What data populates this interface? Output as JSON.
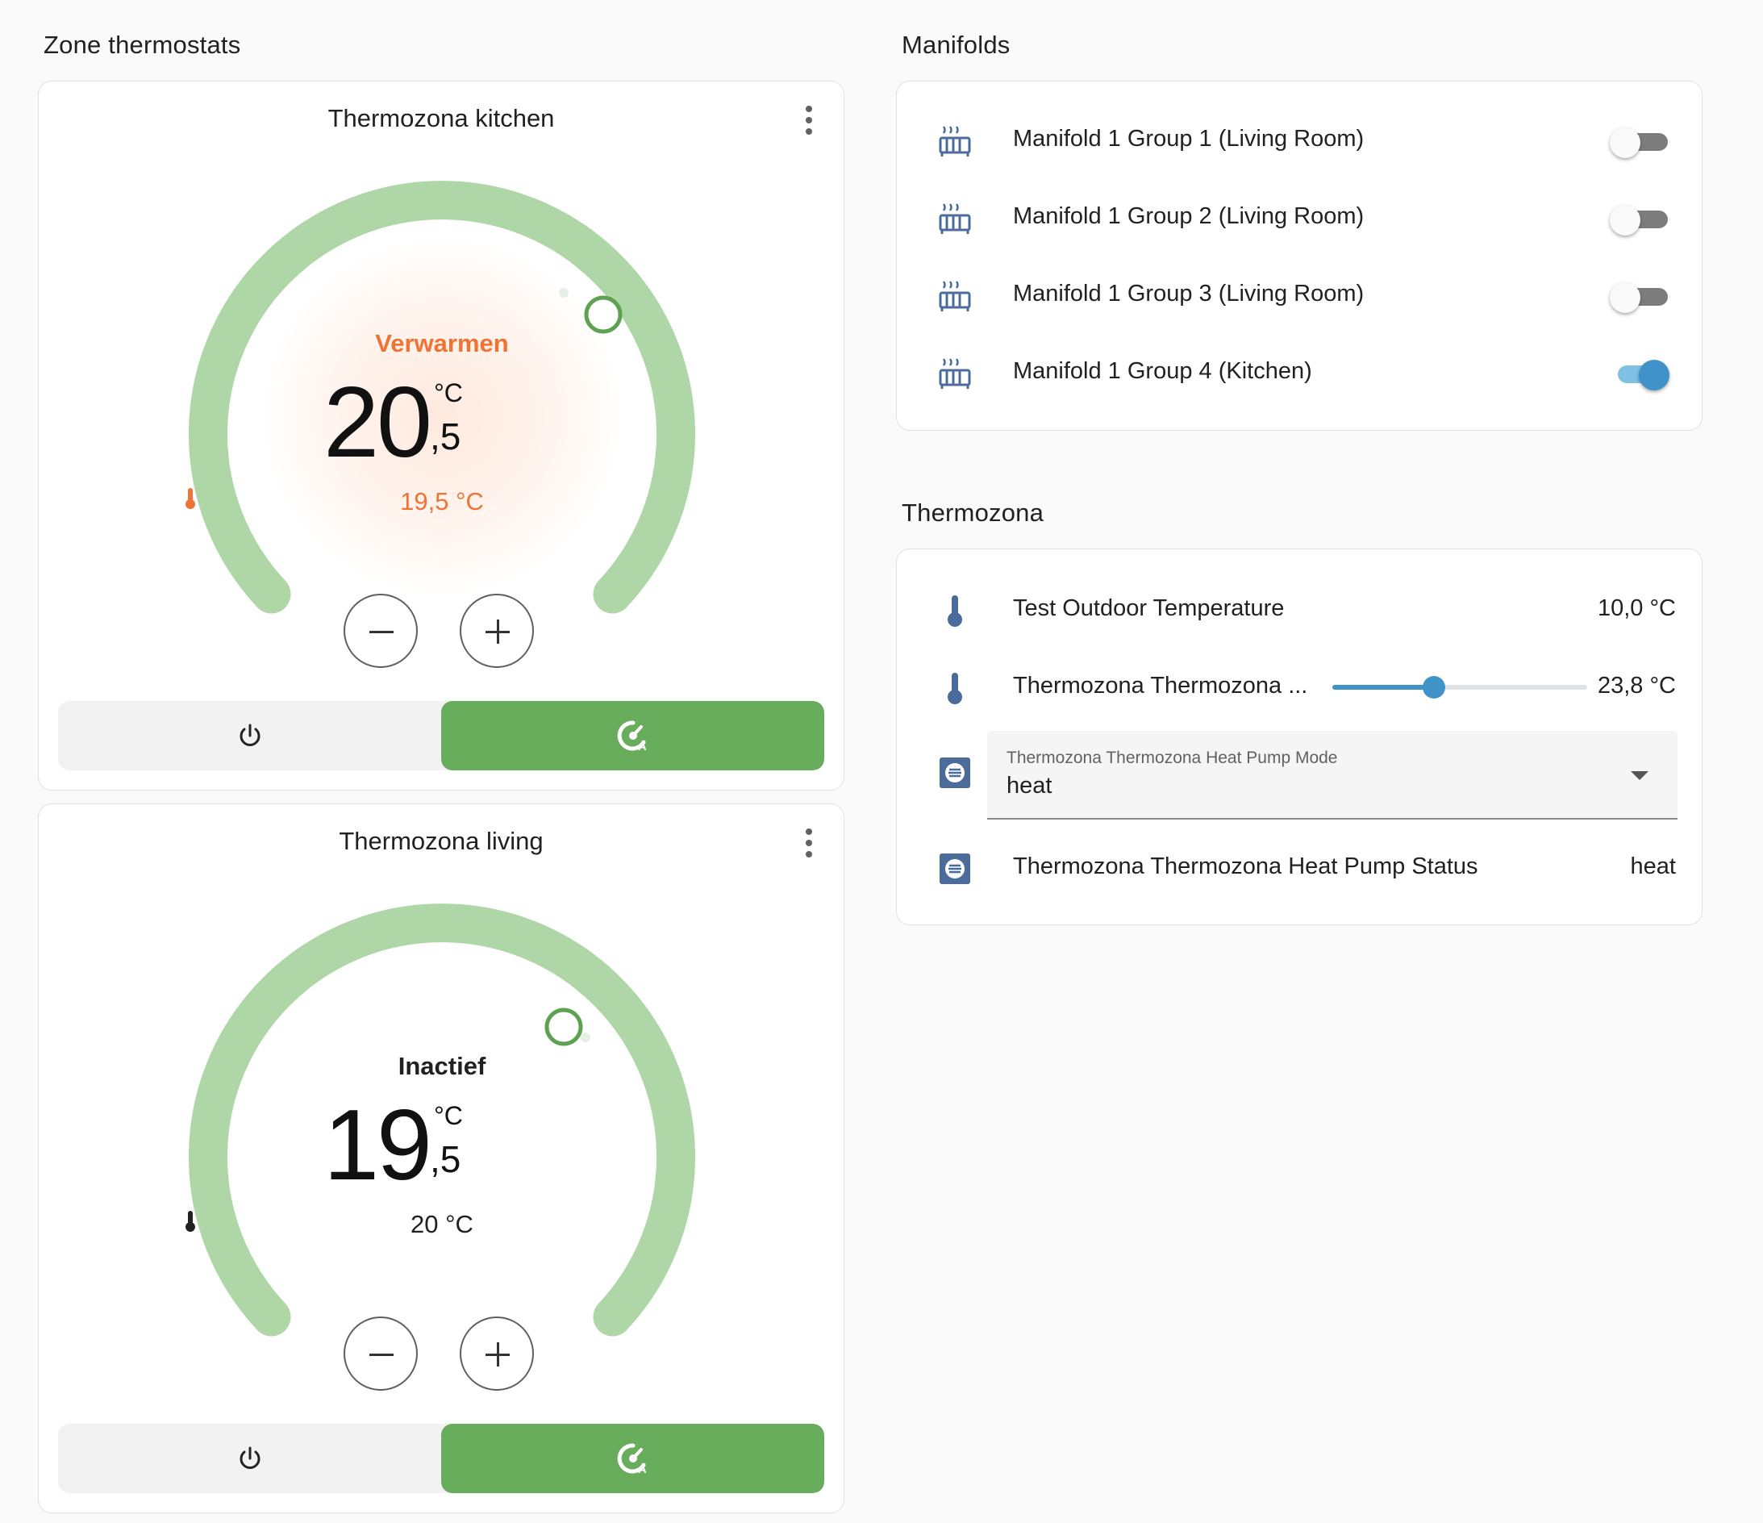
{
  "sections": {
    "zones_title": "Zone thermostats",
    "manifolds_title": "Manifolds",
    "thermozona_title": "Thermozona"
  },
  "thermostats": [
    {
      "name": "Thermozona kitchen",
      "state": "Verwarmen",
      "state_color": "#ef7335",
      "target_whole": "20",
      "target_decimal": ",5",
      "unit": "°C",
      "current": "19,5 °C",
      "current_color": "#ef7335",
      "arc_color": "#afd6a7",
      "heating_glow": true,
      "modes": [
        "power-icon",
        "auto-icon"
      ],
      "active_mode": "auto"
    },
    {
      "name": "Thermozona living",
      "state": "Inactief",
      "state_color": "#212121",
      "target_whole": "19",
      "target_decimal": ",5",
      "unit": "°C",
      "current": "20 °C",
      "current_color": "#212121",
      "arc_color": "#afd6a7",
      "heating_glow": false,
      "modes": [
        "power-icon",
        "auto-icon"
      ],
      "active_mode": "auto"
    }
  ],
  "manifolds": [
    {
      "label": "Manifold 1 Group 1 (Living Room)",
      "icon": "radiator-icon",
      "on": false
    },
    {
      "label": "Manifold 1 Group 2 (Living Room)",
      "icon": "radiator-icon",
      "on": false
    },
    {
      "label": "Manifold 1 Group 3 (Living Room)",
      "icon": "radiator-icon",
      "on": false
    },
    {
      "label": "Manifold 1 Group 4 (Kitchen)",
      "icon": "radiator-icon",
      "on": true
    }
  ],
  "thermozona": {
    "outdoor": {
      "label": "Test Outdoor Temperature",
      "value": "10,0 °C",
      "icon": "thermometer-icon"
    },
    "setpoint": {
      "label": "Thermozona Thermozona ...",
      "value": "23,8 °C",
      "icon": "thermometer-icon",
      "slider_fraction": 0.4
    },
    "mode": {
      "label": "Thermozona Thermozona Heat Pump Mode",
      "value": "heat",
      "icon": "list-icon"
    },
    "status": {
      "label": "Thermozona Thermozona Heat Pump Status",
      "value": "heat",
      "icon": "list-icon"
    }
  },
  "colors": {
    "accent_blue": "#3f93c9",
    "icon_blue": "#4b6c9a",
    "active_green": "#68ad5b",
    "heating_orange": "#ef7335"
  }
}
